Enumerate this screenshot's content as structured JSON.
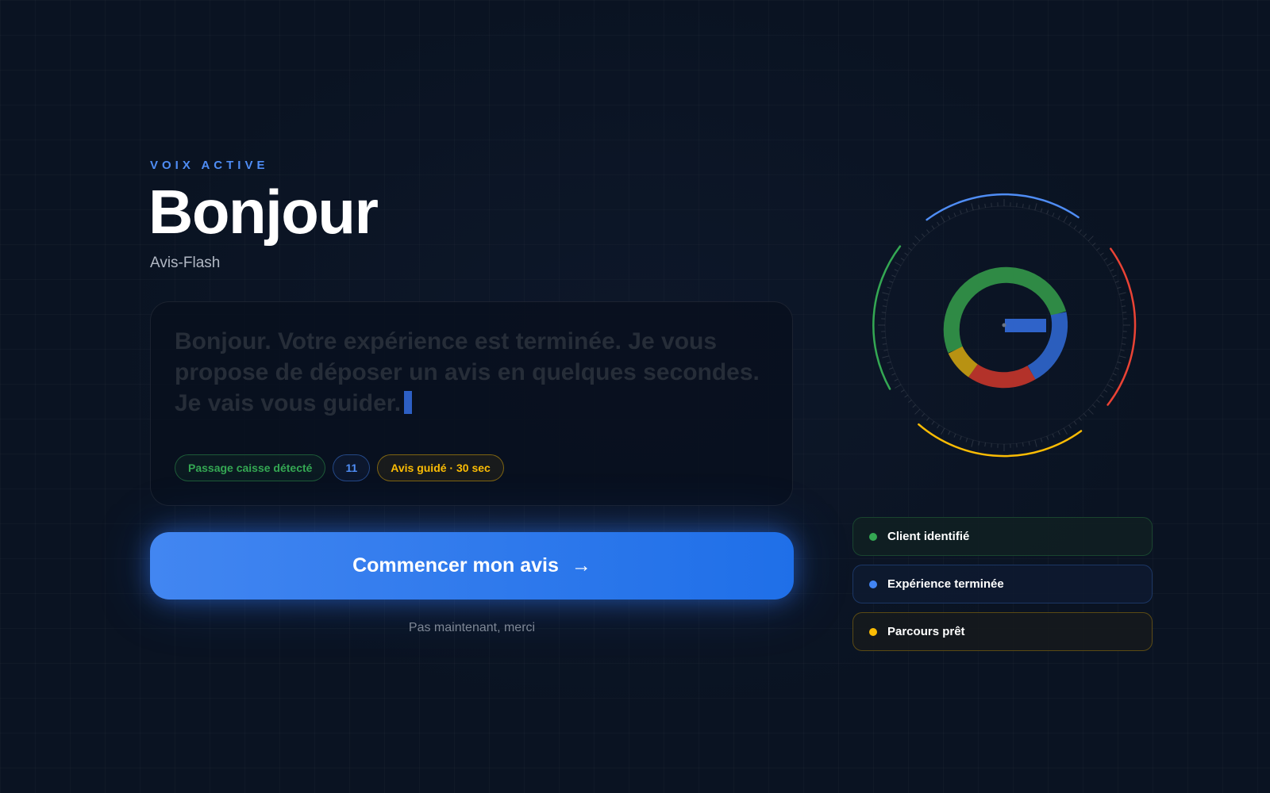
{
  "header": {
    "eyebrow": "VOIX ACTIVE",
    "title": "Bonjour",
    "subtitle": "Avis-Flash"
  },
  "transcript": {
    "text": "Bonjour. Votre expérience est terminée. Je vous propose de déposer un avis en quelques secondes. Je vais vous guider."
  },
  "chips": [
    {
      "label": "Passage caisse détecté",
      "color": "#34a853"
    },
    {
      "label": "11",
      "color": "#4285f4"
    },
    {
      "label": "Avis guidé · 30 sec",
      "color": "#fbbc04"
    }
  ],
  "actions": {
    "primary_label": "Commencer mon avis",
    "primary_icon": "arrow-right-icon",
    "secondary_label": "Pas maintenant, merci"
  },
  "status_items": [
    {
      "label": "Client identifié",
      "color": "#34a853"
    },
    {
      "label": "Expérience terminée",
      "color": "#4285f4"
    },
    {
      "label": "Parcours prêt",
      "color": "#fbbc04"
    }
  ],
  "colors": {
    "background": "#0a1322",
    "accent": "#1f6fe8",
    "green": "#34a853",
    "blue": "#4285f4",
    "red": "#ea4335",
    "yellow": "#fbbc04"
  }
}
